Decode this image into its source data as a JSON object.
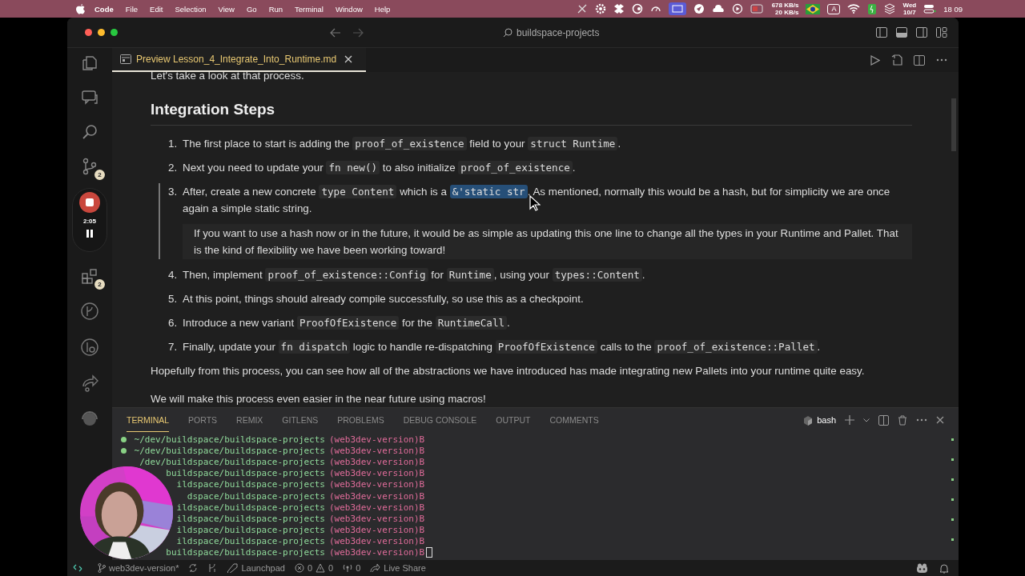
{
  "menubar": {
    "app": "Code",
    "menus": [
      "File",
      "Edit",
      "Selection",
      "View",
      "Go",
      "Run",
      "Terminal",
      "Window",
      "Help"
    ],
    "net_up": "678 KB/s",
    "net_down": "20 KB/s",
    "input": "A",
    "day": "Wed",
    "date": "10/7",
    "time": "18 09"
  },
  "window": {
    "title": "buildspace-projects"
  },
  "activity": {
    "source_badge": "2",
    "extensions_badge": "2"
  },
  "recorder": {
    "time": "2:05"
  },
  "tab": {
    "label": "Preview Lesson_4_Integrate_Into_Runtime.md",
    "selected": true
  },
  "preview": {
    "intro": "Let's take a look at that process.",
    "heading": "Integration Steps",
    "steps": [
      {
        "num": "1.",
        "active": false,
        "parts": [
          {
            "kind": "text",
            "t": "The first place to start is adding the "
          },
          {
            "kind": "code",
            "t": "proof_of_existence"
          },
          {
            "kind": "text",
            "t": " field to your "
          },
          {
            "kind": "code",
            "t": "struct Runtime"
          },
          {
            "kind": "text",
            "t": "."
          }
        ]
      },
      {
        "num": "2.",
        "active": false,
        "parts": [
          {
            "kind": "text",
            "t": "Next you need to update your "
          },
          {
            "kind": "code",
            "t": "fn new()"
          },
          {
            "kind": "text",
            "t": " to also initialize "
          },
          {
            "kind": "code",
            "t": "proof_of_existence"
          },
          {
            "kind": "text",
            "t": "."
          }
        ]
      },
      {
        "num": "3.",
        "active": true,
        "parts": [
          {
            "kind": "text",
            "t": "After, create a new concrete "
          },
          {
            "kind": "code",
            "t": "type Content"
          },
          {
            "kind": "text",
            "t": " which is a "
          },
          {
            "kind": "selected",
            "t": "&'static str"
          },
          {
            "kind": "text",
            "t": ". As mentioned, normally this would be a hash, but for simplicity we are once again a simple static string."
          }
        ],
        "quote": "If you want to use a hash now or in the future, it would be as simple as updating this one line to change all the types in your Runtime and Pallet. That is the kind of flexibility we have been working toward!"
      },
      {
        "num": "4.",
        "active": false,
        "parts": [
          {
            "kind": "text",
            "t": "Then, implement "
          },
          {
            "kind": "code",
            "t": "proof_of_existence::Config"
          },
          {
            "kind": "text",
            "t": " for "
          },
          {
            "kind": "code",
            "t": "Runtime"
          },
          {
            "kind": "text",
            "t": ", using your "
          },
          {
            "kind": "code",
            "t": "types::Content"
          },
          {
            "kind": "text",
            "t": "."
          }
        ]
      },
      {
        "num": "5.",
        "active": false,
        "parts": [
          {
            "kind": "text",
            "t": "At this point, things should already compile successfully, so use this as a checkpoint."
          }
        ]
      },
      {
        "num": "6.",
        "active": false,
        "parts": [
          {
            "kind": "text",
            "t": "Introduce a new variant "
          },
          {
            "kind": "code",
            "t": "ProofOfExistence"
          },
          {
            "kind": "text",
            "t": " for the "
          },
          {
            "kind": "code",
            "t": "RuntimeCall"
          },
          {
            "kind": "text",
            "t": "."
          }
        ]
      },
      {
        "num": "7.",
        "active": false,
        "parts": [
          {
            "kind": "text",
            "t": "Finally, update your "
          },
          {
            "kind": "code",
            "t": "fn dispatch"
          },
          {
            "kind": "text",
            "t": " logic to handle re-dispatching "
          },
          {
            "kind": "code",
            "t": "ProofOfExistence"
          },
          {
            "kind": "text",
            "t": " calls to the "
          },
          {
            "kind": "code",
            "t": "proof_of_existence::Pallet"
          },
          {
            "kind": "text",
            "t": "."
          }
        ]
      }
    ],
    "paragraphs": [
      "Hopefully from this process, you can see how all of the abstractions we have introduced has made integrating new Pallets into your runtime quite easy.",
      "We will make this process even easier in the near future using macros!"
    ]
  },
  "panel": {
    "tabs": [
      {
        "label": "TERMINAL",
        "selected": true
      },
      {
        "label": "PORTS",
        "selected": false
      },
      {
        "label": "REMIX",
        "selected": false
      },
      {
        "label": "GITLENS",
        "selected": false
      },
      {
        "label": "PROBLEMS",
        "selected": false
      },
      {
        "label": "DEBUG CONSOLE",
        "selected": false
      },
      {
        "label": "OUTPUT",
        "selected": false
      },
      {
        "label": "COMMENTS",
        "selected": false
      }
    ],
    "shell": "bash"
  },
  "terminal": [
    {
      "dot": true,
      "path": "~/dev/buildspace/buildspace-projects",
      "branch": "(web3dev-version)B",
      "cursor": false
    },
    {
      "dot": true,
      "path": "~/dev/buildspace/buildspace-projects",
      "branch": "(web3dev-version)B",
      "cursor": false
    },
    {
      "path": "/dev/buildspace/buildspace-projects",
      "branch": "(web3dev-version)B",
      "cursor": false
    },
    {
      "path": "buildspace/buildspace-projects",
      "branch": "(web3dev-version)B",
      "cursor": false
    },
    {
      "path": "ildspace/buildspace-projects",
      "branch": "(web3dev-version)B",
      "cursor": false
    },
    {
      "path": "dspace/buildspace-projects",
      "branch": "(web3dev-version)B",
      "cursor": false
    },
    {
      "path": "ildspace/buildspace-projects",
      "branch": "(web3dev-version)B",
      "cursor": false
    },
    {
      "path": "ildspace/buildspace-projects",
      "branch": "(web3dev-version)B",
      "cursor": false
    },
    {
      "path": "ildspace/buildspace-projects",
      "branch": "(web3dev-version)B",
      "cursor": false
    },
    {
      "path": "ildspace/buildspace-projects",
      "branch": "(web3dev-version)B",
      "cursor": false
    },
    {
      "path": "buildspace/buildspace-projects",
      "branch": "(web3dev-version)B",
      "cursor": true
    }
  ],
  "statusbar": {
    "branch": "web3dev-version*",
    "launchpad": "Launchpad",
    "errors": "0",
    "warnings": "0",
    "ports": "0",
    "live_share": "Live Share"
  }
}
